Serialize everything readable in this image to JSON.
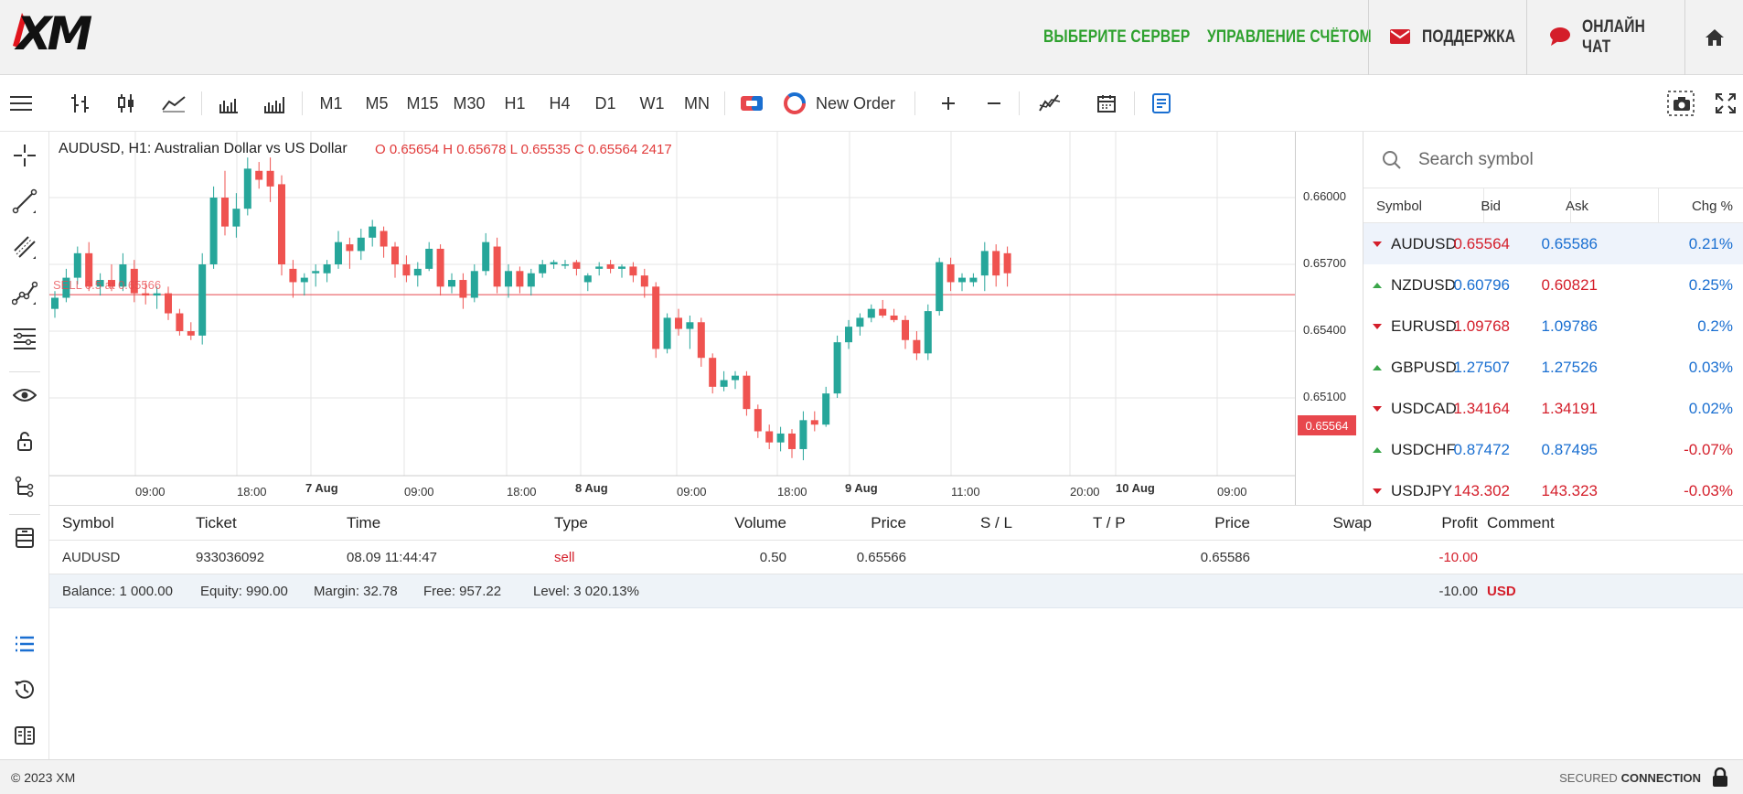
{
  "header": {
    "links": [
      "ВЫБЕРИТЕ СЕРВЕР",
      "УПРАВЛЕНИЕ СЧЁТОМ",
      "ПОДДЕРЖКА",
      "ОНЛАЙН ЧАТ"
    ]
  },
  "toolbar": {
    "timeframes": [
      "M1",
      "M5",
      "M15",
      "M30",
      "H1",
      "H4",
      "D1",
      "W1",
      "MN"
    ],
    "new_order": "New Order"
  },
  "chart": {
    "title": "AUDUSD, H1: Australian Dollar vs US Dollar",
    "ohlc": "O 0.65654 H 0.65678 L 0.65535 C 0.65564 2417",
    "order_line_label": "SELL 0.5 at 0.65566",
    "current_price": "0.65564",
    "y_ticks": [
      "0.66000",
      "0.65700",
      "0.65400",
      "0.65100"
    ],
    "x_ticks": [
      "09:00",
      "18:00",
      "7 Aug",
      "09:00",
      "18:00",
      "8 Aug",
      "09:00",
      "18:00",
      "9 Aug",
      "11:00",
      "20:00",
      "10 Aug",
      "09:00"
    ]
  },
  "chart_data": {
    "type": "candlestick",
    "title": "AUDUSD, H1: Australian Dollar vs US Dollar",
    "ylim": [
      0.6492,
      0.6625
    ],
    "hline": 0.65564,
    "candles": [
      [
        0.655,
        0.6558,
        0.6546,
        0.6555
      ],
      [
        0.6555,
        0.6568,
        0.6553,
        0.6564
      ],
      [
        0.6564,
        0.6578,
        0.6561,
        0.6575
      ],
      [
        0.6575,
        0.658,
        0.6558,
        0.656
      ],
      [
        0.656,
        0.6566,
        0.6556,
        0.6563
      ],
      [
        0.6563,
        0.657,
        0.6558,
        0.656
      ],
      [
        0.656,
        0.6575,
        0.6558,
        0.657
      ],
      [
        0.6568,
        0.6572,
        0.6553,
        0.6557
      ],
      [
        0.6557,
        0.6562,
        0.6552,
        0.6556
      ],
      [
        0.6556,
        0.656,
        0.655,
        0.6557
      ],
      [
        0.6557,
        0.656,
        0.6545,
        0.6548
      ],
      [
        0.6548,
        0.655,
        0.6538,
        0.654
      ],
      [
        0.654,
        0.6544,
        0.6536,
        0.6538
      ],
      [
        0.6538,
        0.6575,
        0.6534,
        0.657
      ],
      [
        0.657,
        0.6605,
        0.6568,
        0.66
      ],
      [
        0.66,
        0.6612,
        0.6583,
        0.6587
      ],
      [
        0.6587,
        0.6602,
        0.6582,
        0.6595
      ],
      [
        0.6595,
        0.6618,
        0.6592,
        0.6613
      ],
      [
        0.6612,
        0.6616,
        0.6604,
        0.6608
      ],
      [
        0.6612,
        0.6618,
        0.6598,
        0.6605
      ],
      [
        0.6606,
        0.661,
        0.6565,
        0.657
      ],
      [
        0.6568,
        0.6572,
        0.6555,
        0.6562
      ],
      [
        0.6562,
        0.6566,
        0.6556,
        0.6564
      ],
      [
        0.6566,
        0.657,
        0.656,
        0.6567
      ],
      [
        0.6566,
        0.6572,
        0.6562,
        0.657
      ],
      [
        0.657,
        0.6585,
        0.6568,
        0.658
      ],
      [
        0.6579,
        0.6582,
        0.6568,
        0.6576
      ],
      [
        0.6576,
        0.6586,
        0.6572,
        0.6582
      ],
      [
        0.6582,
        0.659,
        0.6578,
        0.6587
      ],
      [
        0.6585,
        0.6587,
        0.6573,
        0.6578
      ],
      [
        0.6578,
        0.658,
        0.6564,
        0.657
      ],
      [
        0.657,
        0.6574,
        0.6562,
        0.6565
      ],
      [
        0.6565,
        0.6571,
        0.656,
        0.6568
      ],
      [
        0.6568,
        0.658,
        0.6567,
        0.6577
      ],
      [
        0.6577,
        0.6579,
        0.6556,
        0.656
      ],
      [
        0.656,
        0.6566,
        0.6557,
        0.6563
      ],
      [
        0.6563,
        0.6566,
        0.655,
        0.6555
      ],
      [
        0.6555,
        0.657,
        0.6553,
        0.6567
      ],
      [
        0.6567,
        0.6584,
        0.6565,
        0.658
      ],
      [
        0.6578,
        0.6582,
        0.6557,
        0.656
      ],
      [
        0.656,
        0.657,
        0.6555,
        0.6567
      ],
      [
        0.6567,
        0.6569,
        0.6557,
        0.656
      ],
      [
        0.656,
        0.6568,
        0.6556,
        0.6566
      ],
      [
        0.6566,
        0.6572,
        0.6564,
        0.657
      ],
      [
        0.657,
        0.6572,
        0.6568,
        0.6571
      ],
      [
        0.657,
        0.6572,
        0.6568,
        0.657
      ],
      [
        0.6571,
        0.6572,
        0.6565,
        0.6568
      ],
      [
        0.6562,
        0.6566,
        0.6558,
        0.6565
      ],
      [
        0.6568,
        0.6571,
        0.6565,
        0.6569
      ],
      [
        0.657,
        0.6572,
        0.6566,
        0.6568
      ],
      [
        0.6568,
        0.657,
        0.6564,
        0.6569
      ],
      [
        0.6569,
        0.6571,
        0.6562,
        0.6565
      ],
      [
        0.6565,
        0.6568,
        0.6555,
        0.656
      ],
      [
        0.656,
        0.6562,
        0.6528,
        0.6532
      ],
      [
        0.6532,
        0.6548,
        0.653,
        0.6546
      ],
      [
        0.6546,
        0.655,
        0.6538,
        0.6541
      ],
      [
        0.6541,
        0.6547,
        0.6532,
        0.6544
      ],
      [
        0.6544,
        0.6546,
        0.6524,
        0.6528
      ],
      [
        0.6528,
        0.653,
        0.6512,
        0.6515
      ],
      [
        0.6515,
        0.6522,
        0.6513,
        0.6518
      ],
      [
        0.6518,
        0.6522,
        0.6514,
        0.652
      ],
      [
        0.652,
        0.6522,
        0.6502,
        0.6505
      ],
      [
        0.6505,
        0.6507,
        0.6492,
        0.6495
      ],
      [
        0.6495,
        0.6498,
        0.6487,
        0.649
      ],
      [
        0.649,
        0.6497,
        0.6486,
        0.6494
      ],
      [
        0.6494,
        0.6496,
        0.6483,
        0.6487
      ],
      [
        0.6487,
        0.6504,
        0.6482,
        0.65
      ],
      [
        0.65,
        0.6504,
        0.6495,
        0.6498
      ],
      [
        0.6498,
        0.6515,
        0.6497,
        0.6512
      ],
      [
        0.6512,
        0.6538,
        0.651,
        0.6535
      ],
      [
        0.6535,
        0.6545,
        0.6532,
        0.6542
      ],
      [
        0.6542,
        0.6548,
        0.6538,
        0.6546
      ],
      [
        0.6546,
        0.6552,
        0.6544,
        0.655
      ],
      [
        0.655,
        0.6554,
        0.6546,
        0.6547
      ],
      [
        0.6547,
        0.655,
        0.6544,
        0.6545
      ],
      [
        0.6545,
        0.6547,
        0.6532,
        0.6536
      ],
      [
        0.6536,
        0.654,
        0.6527,
        0.653
      ],
      [
        0.653,
        0.6552,
        0.6527,
        0.6549
      ],
      [
        0.6549,
        0.6573,
        0.6547,
        0.6571
      ],
      [
        0.657,
        0.6573,
        0.6558,
        0.6562
      ],
      [
        0.6562,
        0.6566,
        0.6558,
        0.6564
      ],
      [
        0.6562,
        0.6566,
        0.656,
        0.6564
      ],
      [
        0.6565,
        0.658,
        0.6558,
        0.6576
      ],
      [
        0.6576,
        0.6579,
        0.656,
        0.6565
      ],
      [
        0.6575,
        0.6578,
        0.656,
        0.6566
      ]
    ]
  },
  "watchlist": {
    "search_placeholder": "Search symbol",
    "columns": [
      "Symbol",
      "Bid",
      "Ask",
      "Chg %"
    ],
    "rows": [
      {
        "symbol": "AUDUSD",
        "dir": "down",
        "bid": "0.65564",
        "ask": "0.65586",
        "chg": "0.21%",
        "bid_color": "red",
        "ask_color": "blue",
        "chg_color": "blue"
      },
      {
        "symbol": "NZDUSD",
        "dir": "up",
        "bid": "0.60796",
        "ask": "0.60821",
        "chg": "0.25%",
        "bid_color": "blue",
        "ask_color": "red",
        "chg_color": "blue"
      },
      {
        "symbol": "EURUSD",
        "dir": "down",
        "bid": "1.09768",
        "ask": "1.09786",
        "chg": "0.2%",
        "bid_color": "red",
        "ask_color": "blue",
        "chg_color": "blue"
      },
      {
        "symbol": "GBPUSD",
        "dir": "up",
        "bid": "1.27507",
        "ask": "1.27526",
        "chg": "0.03%",
        "bid_color": "blue",
        "ask_color": "blue",
        "chg_color": "blue"
      },
      {
        "symbol": "USDCAD",
        "dir": "down",
        "bid": "1.34164",
        "ask": "1.34191",
        "chg": "0.02%",
        "bid_color": "red",
        "ask_color": "red",
        "chg_color": "blue"
      },
      {
        "symbol": "USDCHF",
        "dir": "up",
        "bid": "0.87472",
        "ask": "0.87495",
        "chg": "-0.07%",
        "bid_color": "blue",
        "ask_color": "blue",
        "chg_color": "red"
      },
      {
        "symbol": "USDJPY",
        "dir": "down",
        "bid": "143.302",
        "ask": "143.323",
        "chg": "-0.03%",
        "bid_color": "red",
        "ask_color": "red",
        "chg_color": "red"
      }
    ]
  },
  "trades": {
    "columns": [
      "Symbol",
      "Ticket",
      "Time",
      "Type",
      "Volume",
      "Price",
      "S / L",
      "T / P",
      "Price",
      "Swap",
      "Profit",
      "Comment"
    ],
    "row": {
      "symbol": "AUDUSD",
      "ticket": "933036092",
      "time": "08.09 11:44:47",
      "type": "sell",
      "volume": "0.50",
      "price": "0.65566",
      "sl": "",
      "tp": "",
      "cur_price": "0.65586",
      "swap": "",
      "profit": "-10.00",
      "comment": ""
    },
    "summary": {
      "balance": "Balance: 1 000.00",
      "equity": "Equity: 990.00",
      "margin": "Margin: 32.78",
      "free": "Free: 957.22",
      "level": "Level: 3 020.13%",
      "profit": "-10.00",
      "currency": "USD"
    }
  },
  "footer": {
    "copyright": "© 2023 XM",
    "secured": "SECURED",
    "connection": "CONNECTION"
  },
  "colors": {
    "bull": "#26a69a",
    "bear": "#ef5350",
    "green": "#2ea12e",
    "red": "#d41e2a",
    "blue": "#1a6fd1"
  }
}
